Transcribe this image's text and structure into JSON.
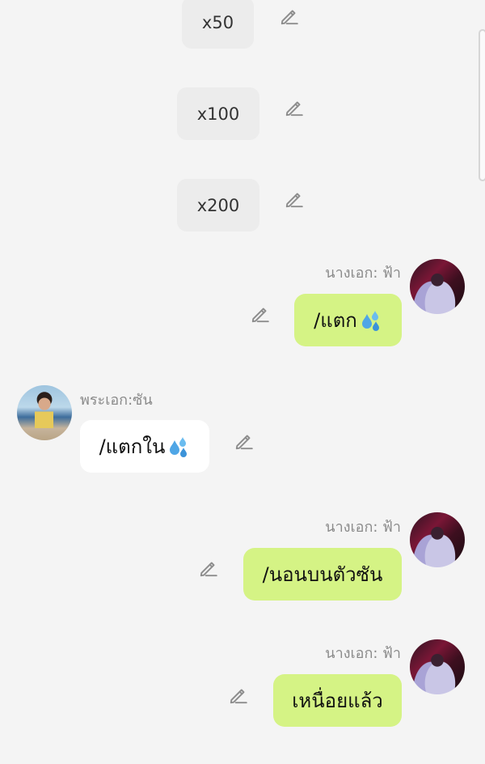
{
  "multipliers": [
    "x50",
    "x100",
    "x200"
  ],
  "messages": [
    {
      "sender": "นางเอก: ฟ้า",
      "text": "/แตก",
      "emoji": "sweat-droplets",
      "side": "right"
    },
    {
      "sender": "พระเอก:ซัน",
      "text": "/แตกใน",
      "emoji": "sweat-droplets",
      "side": "left"
    },
    {
      "sender": "นางเอก: ฟ้า",
      "text": "/นอนบนตัวซัน",
      "side": "right"
    },
    {
      "sender": "นางเอก: ฟ้า",
      "text": "เหนื่อยแล้ว",
      "side": "right"
    }
  ],
  "colors": {
    "right_bubble": "#d5f385",
    "left_bubble": "#ffffff",
    "background": "#f4f4f4",
    "pill": "#ececec",
    "sender_name": "#8a8a8a"
  }
}
